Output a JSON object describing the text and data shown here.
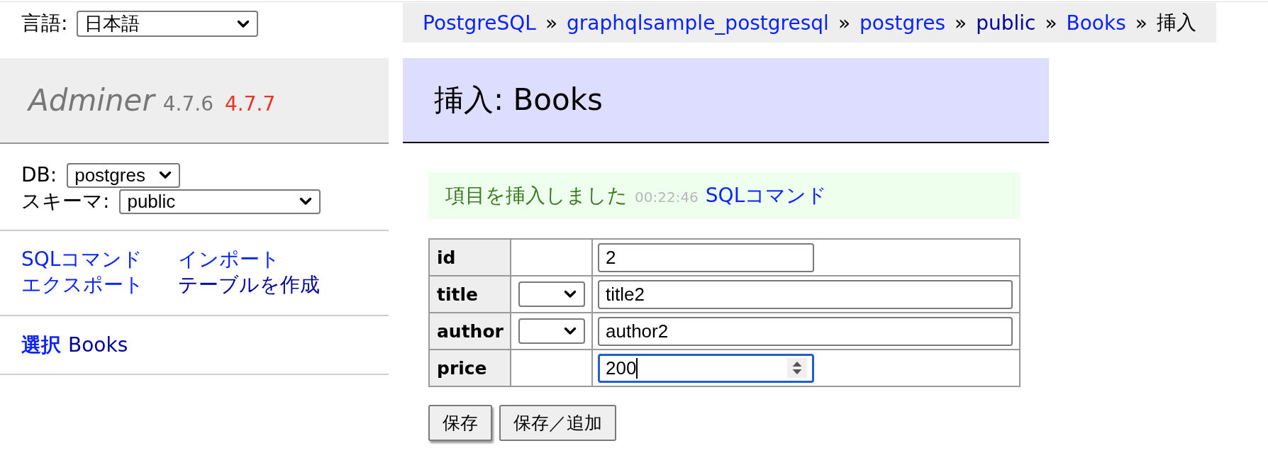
{
  "language": {
    "label": "言語:",
    "value": "日本語"
  },
  "logo": {
    "name": "Adminer",
    "version": "4.7.6",
    "new_version": "4.7.7"
  },
  "database": {
    "label": "DB:",
    "value": "postgres"
  },
  "schema": {
    "label": "スキーマ:",
    "value": "public"
  },
  "sidebar_links": [
    {
      "label": "SQLコマンド",
      "visited": false
    },
    {
      "label": "インポート",
      "visited": false
    },
    {
      "label": "エクスポート",
      "visited": false
    },
    {
      "label": "テーブルを作成",
      "visited": true
    }
  ],
  "tables": [
    {
      "select": {
        "label": "選択",
        "visited": false
      },
      "name": {
        "label": "Books",
        "visited": true
      }
    }
  ],
  "breadcrumb": {
    "links": [
      {
        "label": "PostgreSQL",
        "visited": false
      },
      {
        "label": "graphqlsample_postgresql",
        "visited": false
      },
      {
        "label": "postgres",
        "visited": false
      },
      {
        "label": "public",
        "visited": true
      },
      {
        "label": "Books",
        "visited": false
      }
    ],
    "separators": [
      "»",
      "»",
      "»",
      "»",
      "»"
    ],
    "current": "挿入"
  },
  "heading": "挿入: Books",
  "message": {
    "text": "項目を挿入しました",
    "time": "00:22:46",
    "link": "SQLコマンド"
  },
  "form": {
    "rows": [
      {
        "name": "id",
        "kind": "number",
        "value": "2",
        "focused": false
      },
      {
        "name": "title",
        "kind": "text",
        "value": "title2",
        "focused": false
      },
      {
        "name": "author",
        "kind": "text",
        "value": "author2",
        "focused": false
      },
      {
        "name": "price",
        "kind": "number",
        "value": "200",
        "focused": true
      }
    ]
  },
  "buttons": [
    {
      "label": "保存",
      "default": true
    },
    {
      "label": "保存／追加",
      "default": false
    }
  ]
}
